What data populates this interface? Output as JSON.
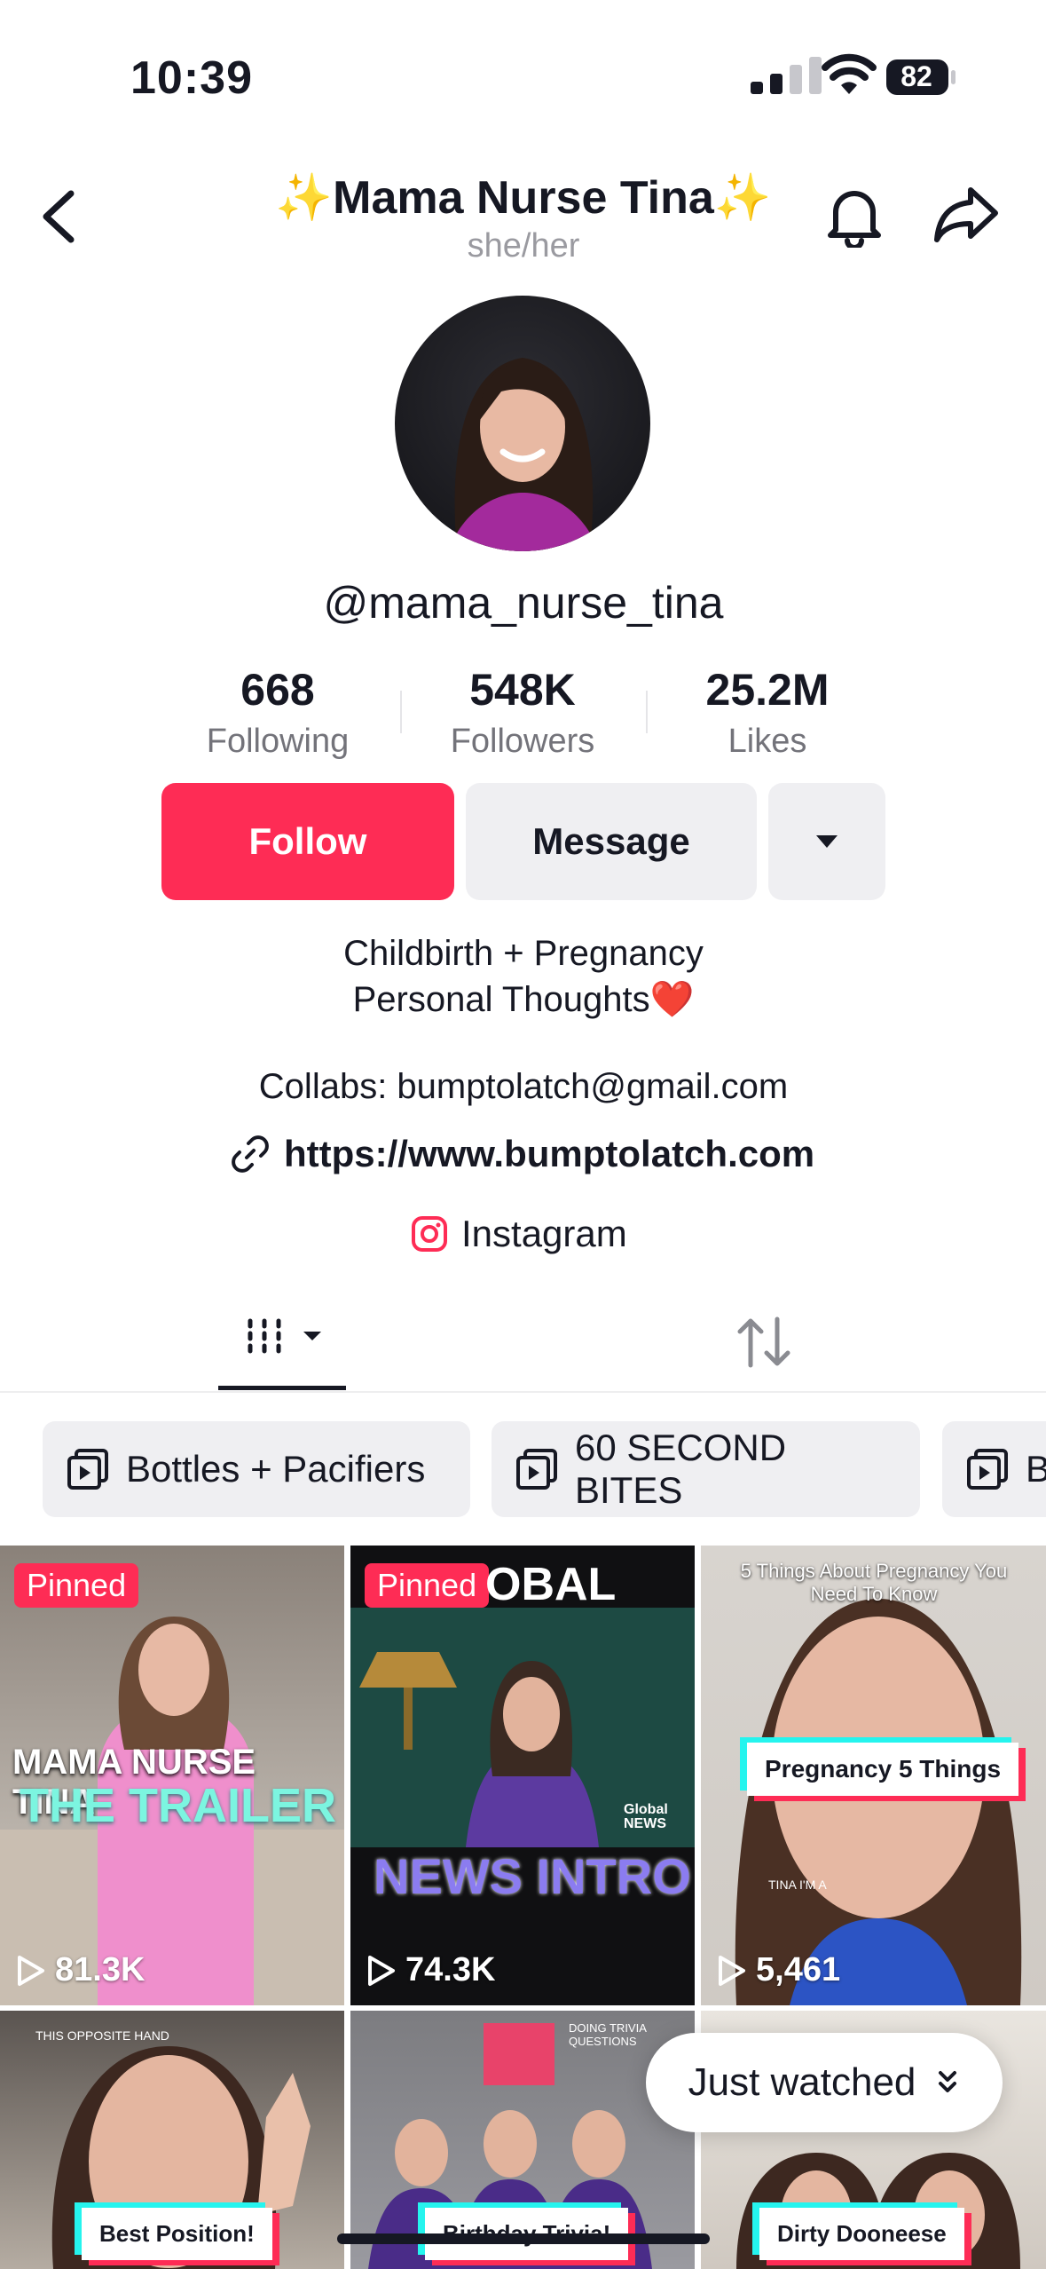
{
  "status_bar": {
    "time": "10:39",
    "battery": "82"
  },
  "header": {
    "title": "✨Mama Nurse Tina✨",
    "pronouns": "she/her"
  },
  "profile": {
    "username": "@mama_nurse_tina",
    "stats": [
      {
        "value": "668",
        "label": "Following"
      },
      {
        "value": "548K",
        "label": "Followers"
      },
      {
        "value": "25.2M",
        "label": "Likes"
      }
    ],
    "follow_label": "Follow",
    "message_label": "Message",
    "bio_line1": "Childbirth + Pregnancy",
    "bio_line2": "Personal Thoughts❤️",
    "collabs": "Collabs: bumptolatch@gmail.com",
    "link": "https://www.bumptolatch.com",
    "instagram": "Instagram"
  },
  "playlists": [
    {
      "label": "Bottles + Pacifiers"
    },
    {
      "label": "60 SECOND BITES"
    },
    {
      "label": "B"
    }
  ],
  "videos": [
    {
      "pinned": "Pinned",
      "views": "81.3K",
      "overlay1": "MAMA NURSE TINA",
      "overlay2": "THE TRAILER"
    },
    {
      "pinned": "Pinned",
      "views": "74.3K",
      "overlay1": "OBAL",
      "overlay2": "NEWS INTRO",
      "logo": "Global NEWS"
    },
    {
      "views": "5,461",
      "overlay_top": "5 Things About Pregnancy You Need To Know",
      "overlay_box": "Pregnancy 5 Things",
      "overlay_small": "TINA I'M A"
    },
    {
      "overlay_top": "THIS OPPOSITE HAND",
      "overlay_box": "Best Position!"
    },
    {
      "overlay_top": "DOING TRIVIA QUESTIONS",
      "overlay_box": "Birthday Trivia!"
    },
    {
      "overlay_box": "Dirty Dooneese"
    }
  ],
  "just_watched": "Just watched",
  "colors": {
    "accent": "#fe2c55",
    "chip_bg": "#efeff2",
    "text": "#161823"
  }
}
